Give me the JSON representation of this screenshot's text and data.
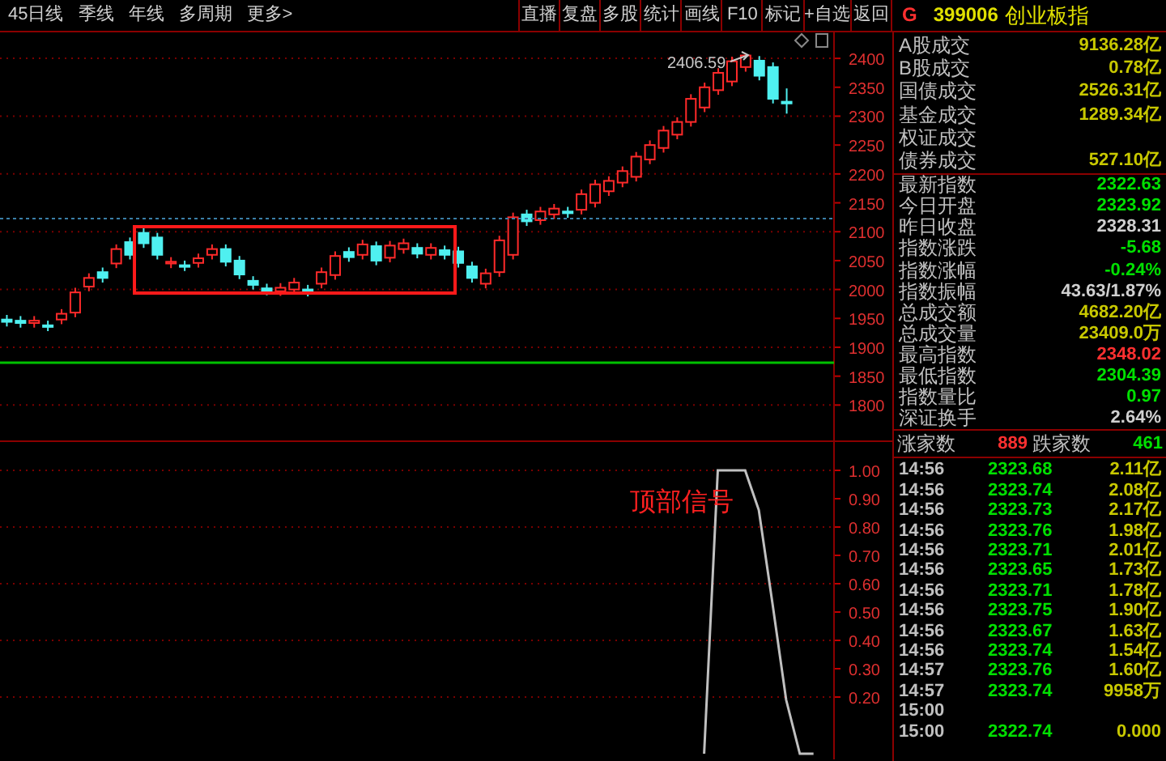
{
  "toolbar": {
    "periods": [
      "45日线",
      "季线",
      "年线",
      "多周期",
      "更多>"
    ],
    "buttons": [
      "直播",
      "复盘",
      "多股",
      "统计",
      "画线",
      "F10",
      "标记",
      "+自选",
      "返回"
    ]
  },
  "quote_header": {
    "flag": "G",
    "code": "399006",
    "name": "创业板指"
  },
  "main_chart": {
    "chart_data": {
      "type": "candlestick",
      "categories": [
        null,
        null,
        null,
        null,
        null,
        null,
        null,
        null,
        null,
        null,
        null,
        null,
        null,
        null,
        null,
        null,
        null,
        null,
        null,
        null,
        null,
        null,
        null,
        null,
        null,
        null,
        null,
        null,
        null,
        null,
        null,
        null,
        null,
        null,
        null,
        null,
        null,
        null,
        null,
        null,
        null,
        null,
        null,
        null,
        null,
        null,
        null,
        null,
        null,
        null,
        null,
        null,
        null,
        null,
        null,
        null,
        null,
        null
      ],
      "ohlc": [
        [
          1948,
          1956,
          1936,
          1944
        ],
        [
          1946,
          1954,
          1934,
          1942
        ],
        [
          1942,
          1954,
          1934,
          1946
        ],
        [
          1938,
          1946,
          1928,
          1936
        ],
        [
          1948,
          1966,
          1940,
          1958
        ],
        [
          1960,
          2003,
          1952,
          1995
        ],
        [
          2005,
          2028,
          1997,
          2020
        ],
        [
          2030,
          2038,
          2012,
          2020
        ],
        [
          2045,
          2078,
          2037,
          2070
        ],
        [
          2082,
          2090,
          2052,
          2060
        ],
        [
          2098,
          2106,
          2072,
          2080
        ],
        [
          2090,
          2098,
          2052,
          2060
        ],
        [
          2045,
          2056,
          2037,
          2048
        ],
        [
          2042,
          2050,
          2032,
          2040
        ],
        [
          2046,
          2062,
          2038,
          2054
        ],
        [
          2060,
          2078,
          2052,
          2070
        ],
        [
          2070,
          2078,
          2040,
          2048
        ],
        [
          2050,
          2058,
          2018,
          2026
        ],
        [
          2015,
          2023,
          2000,
          2008
        ],
        [
          2002,
          2010,
          1990,
          1998
        ],
        [
          1997,
          2011,
          1989,
          2003
        ],
        [
          2000,
          2020,
          1992,
          2012
        ],
        [
          2000,
          2008,
          1988,
          1996
        ],
        [
          2010,
          2038,
          2002,
          2030
        ],
        [
          2025,
          2066,
          2017,
          2058
        ],
        [
          2065,
          2073,
          2048,
          2056
        ],
        [
          2060,
          2086,
          2052,
          2078
        ],
        [
          2075,
          2083,
          2042,
          2050
        ],
        [
          2055,
          2084,
          2047,
          2076
        ],
        [
          2070,
          2088,
          2062,
          2080
        ],
        [
          2072,
          2080,
          2054,
          2062
        ],
        [
          2060,
          2080,
          2052,
          2072
        ],
        [
          2068,
          2076,
          2052,
          2060
        ],
        [
          2066,
          2074,
          2038,
          2046
        ],
        [
          2040,
          2048,
          2012,
          2020
        ],
        [
          2010,
          2036,
          2002,
          2028
        ],
        [
          2030,
          2093,
          2022,
          2085
        ],
        [
          2060,
          2133,
          2052,
          2125
        ],
        [
          2130,
          2138,
          2110,
          2118
        ],
        [
          2120,
          2143,
          2112,
          2135
        ],
        [
          2130,
          2148,
          2122,
          2140
        ],
        [
          2135,
          2143,
          2124,
          2132
        ],
        [
          2138,
          2173,
          2130,
          2165
        ],
        [
          2150,
          2190,
          2142,
          2182
        ],
        [
          2170,
          2196,
          2162,
          2188
        ],
        [
          2185,
          2213,
          2177,
          2205
        ],
        [
          2195,
          2238,
          2187,
          2230
        ],
        [
          2225,
          2258,
          2217,
          2250
        ],
        [
          2245,
          2283,
          2237,
          2275
        ],
        [
          2268,
          2298,
          2260,
          2290
        ],
        [
          2290,
          2338,
          2282,
          2330
        ],
        [
          2315,
          2358,
          2307,
          2350
        ],
        [
          2345,
          2383,
          2337,
          2375
        ],
        [
          2360,
          2403,
          2352,
          2395
        ],
        [
          2385,
          2406.59,
          2377,
          2405
        ],
        [
          2396,
          2404,
          2362,
          2370
        ],
        [
          2385,
          2393,
          2322,
          2330
        ],
        [
          2325,
          2348.02,
          2304.39,
          2322
        ]
      ],
      "ylim": [
        1736,
        2445
      ],
      "yticks": [
        2400,
        2350,
        2300,
        2250,
        2200,
        2150,
        2100,
        2050,
        2000,
        1950,
        1900,
        1850,
        1800
      ],
      "grid": true,
      "annotations": [
        {
          "text": "2406.59"
        }
      ]
    }
  },
  "indicator_chart": {
    "chart_data": {
      "type": "line",
      "categories": [
        null,
        null,
        null,
        null,
        null,
        null,
        null,
        null,
        null,
        null,
        null,
        null,
        null,
        null,
        null,
        null,
        null,
        null,
        null,
        null,
        null,
        null,
        null,
        null,
        null,
        null,
        null,
        null,
        null,
        null,
        null,
        null,
        null,
        null,
        null,
        null,
        null,
        null,
        null,
        null,
        null,
        null,
        null,
        null,
        null,
        null,
        null,
        null,
        null,
        null,
        null,
        null,
        null,
        null,
        null,
        null,
        null,
        null,
        null,
        null,
        null
      ],
      "series": [
        {
          "color": "#c0c0c0",
          "values": [
            null,
            null,
            null,
            null,
            null,
            null,
            null,
            null,
            null,
            null,
            null,
            null,
            null,
            null,
            null,
            null,
            null,
            null,
            null,
            null,
            null,
            null,
            null,
            null,
            null,
            null,
            null,
            null,
            null,
            null,
            null,
            null,
            null,
            null,
            null,
            null,
            null,
            null,
            null,
            null,
            null,
            null,
            null,
            null,
            null,
            null,
            null,
            null,
            null,
            null,
            null,
            0,
            1,
            1,
            1,
            0.86,
            0.53,
            0.19,
            0,
            0,
            null
          ]
        }
      ],
      "ylim": [
        -0.02,
        1.1
      ],
      "yticks": [
        {
          "value": 1,
          "label": "1.00"
        },
        {
          "value": 0.9,
          "label": "0.90"
        },
        {
          "value": 0.8,
          "label": "0.80"
        },
        {
          "value": 0.7,
          "label": "0.70"
        },
        {
          "value": 0.6,
          "label": "0.60"
        },
        {
          "value": 0.5,
          "label": "0.50"
        },
        {
          "value": 0.4,
          "label": "0.40"
        },
        {
          "value": 0.3,
          "label": "0.30"
        },
        {
          "value": 0.2,
          "label": "0.20"
        }
      ],
      "grid": true,
      "annotations": [
        {
          "text": "顶部信号"
        }
      ]
    }
  },
  "turnover": [
    {
      "label": "A股成交",
      "value": "9136.28亿",
      "color": "#c8c800"
    },
    {
      "label": "B股成交",
      "value": "0.78亿",
      "color": "#c8c800"
    },
    {
      "label": "国债成交",
      "value": "2526.31亿",
      "color": "#c8c800"
    },
    {
      "label": "基金成交",
      "value": "1289.34亿",
      "color": "#c8c800"
    },
    {
      "label": "权证成交"
    },
    {
      "label": "债券成交",
      "value": "527.10亿",
      "color": "#c8c800"
    }
  ],
  "index_stats": [
    {
      "label": "最新指数",
      "value": "2322.63",
      "color": "#00e000"
    },
    {
      "label": "今日开盘",
      "value": "2323.92",
      "color": "#00e000"
    },
    {
      "label": "昨日收盘",
      "value": "2328.31",
      "color": "#d0d0d0"
    },
    {
      "label": "指数涨跌",
      "value": "-5.68",
      "color": "#00e000"
    },
    {
      "label": "指数涨幅",
      "value": "-0.24%",
      "color": "#00e000"
    },
    {
      "label": "指数振幅",
      "value": "43.63/1.87%",
      "color": "#d0d0d0"
    },
    {
      "label": "总成交额",
      "value": "4682.20亿",
      "color": "#c8c800"
    },
    {
      "label": "总成交量",
      "value": "23409.0万",
      "color": "#c8c800"
    },
    {
      "label": "最高指数",
      "value": "2348.02",
      "color": "#ff3030"
    },
    {
      "label": "最低指数",
      "value": "2304.39",
      "color": "#00e000"
    },
    {
      "label": "指数量比",
      "value": "0.97",
      "color": "#00e000"
    },
    {
      "label": "深证换手",
      "value": "2.64%",
      "color": "#d0d0d0"
    }
  ],
  "breadth": {
    "up_label": "涨家数",
    "up_count": "889",
    "down_label": "跌家数",
    "down_count": "461"
  },
  "ticks": [
    {
      "time": "14:56",
      "price": "2323.68",
      "volume": "2.11亿"
    },
    {
      "time": "14:56",
      "price": "2323.74",
      "volume": "2.08亿"
    },
    {
      "time": "14:56",
      "price": "2323.73",
      "volume": "2.17亿"
    },
    {
      "time": "14:56",
      "price": "2323.76",
      "volume": "1.98亿"
    },
    {
      "time": "14:56",
      "price": "2323.71",
      "volume": "2.01亿"
    },
    {
      "time": "14:56",
      "price": "2323.65",
      "volume": "1.73亿"
    },
    {
      "time": "14:56",
      "price": "2323.71",
      "volume": "1.78亿"
    },
    {
      "time": "14:56",
      "price": "2323.75",
      "volume": "1.90亿"
    },
    {
      "time": "14:56",
      "price": "2323.67",
      "volume": "1.63亿"
    },
    {
      "time": "14:56",
      "price": "2323.74",
      "volume": "1.54亿"
    },
    {
      "time": "14:57",
      "price": "2323.76",
      "volume": "1.60亿"
    },
    {
      "time": "14:57",
      "price": "2323.74",
      "volume": "9958万"
    },
    {
      "time": "15:00"
    },
    {
      "time": "15:00",
      "price": "2322.74",
      "volume": "0.000"
    }
  ]
}
